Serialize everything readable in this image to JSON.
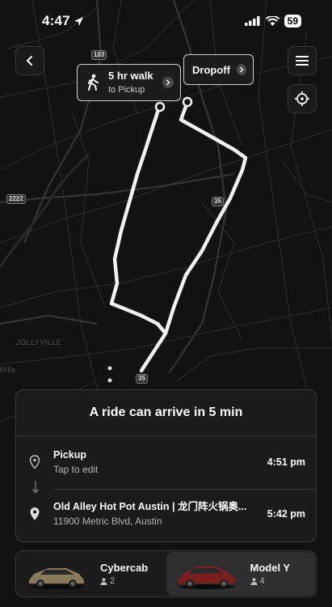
{
  "status_bar": {
    "time": "4:47",
    "battery": "59"
  },
  "map": {
    "shields": [
      "183",
      "2222",
      "35",
      "35"
    ],
    "labels": [
      "JOLLYVILLE",
      "Hills"
    ]
  },
  "callouts": {
    "walk": {
      "title": "5 hr walk",
      "subtitle": "to Pickup",
      "icon": "walking-person-icon"
    },
    "dropoff": {
      "title": "Dropoff"
    }
  },
  "ride_sheet": {
    "title": "A ride can arrive in 5 min",
    "pickup": {
      "title": "Pickup",
      "subtitle": "Tap to edit",
      "time": "4:51 pm"
    },
    "dropoff": {
      "title": "Old Alley Hot Pot Austin | 龙门阵火锅奥...",
      "subtitle": "11900 Metric Blvd, Austin",
      "time": "5:42 pm"
    }
  },
  "vehicles": [
    {
      "name": "Cybercab",
      "capacity": "2",
      "color": "#8a7a5c",
      "selected": false
    },
    {
      "name": "Model Y",
      "capacity": "4",
      "color": "#7a1f1f",
      "selected": true
    }
  ]
}
